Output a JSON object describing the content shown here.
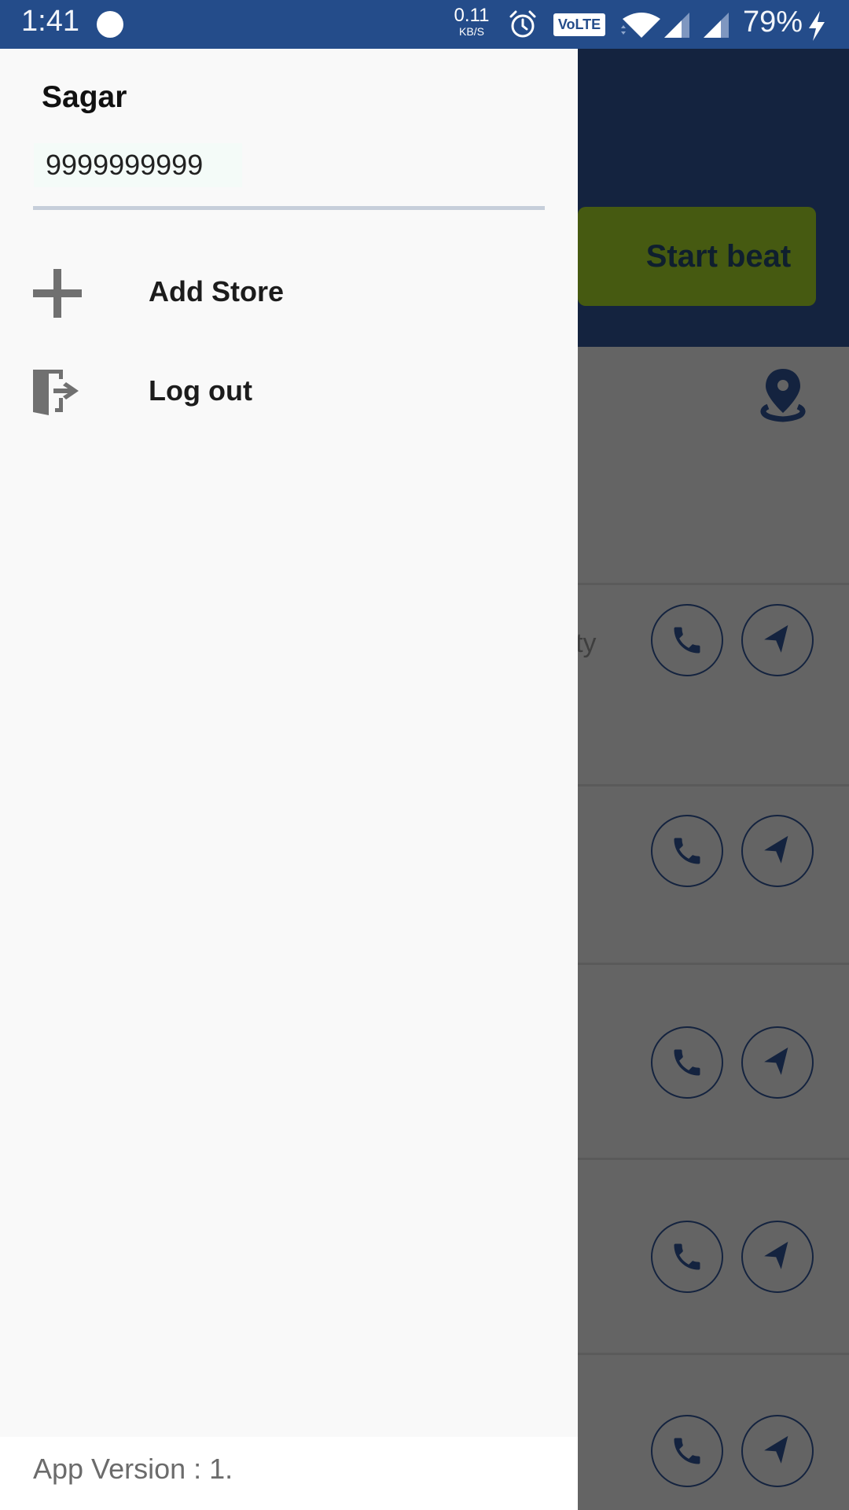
{
  "status_bar": {
    "time": "1:41",
    "net_speed_value": "0.11",
    "net_speed_unit": "KB/S",
    "volte_label": "VoLTE",
    "battery": "79%",
    "icons": [
      "notification-dot-icon",
      "alarm-icon",
      "volte-icon",
      "wifi-icon",
      "signal-icon",
      "signal-icon",
      "charging-bolt-icon"
    ]
  },
  "drawer": {
    "user_name": "Sagar",
    "user_phone": "9999999999",
    "menu": [
      {
        "label": "Add Store",
        "icon": "plus-icon"
      },
      {
        "label": "Log out",
        "icon": "logout-door-icon"
      }
    ],
    "app_version": "App Version : 1."
  },
  "background_app": {
    "start_beat_label": "Start beat",
    "location_icon": "location-pin-icon",
    "store_rows": [
      {
        "city": "City",
        "actions": [
          "call",
          "navigate"
        ]
      },
      {
        "city": "",
        "actions": [
          "call",
          "navigate"
        ]
      },
      {
        "city": "",
        "actions": [
          "call",
          "navigate"
        ]
      },
      {
        "city": "",
        "actions": [
          "call",
          "navigate"
        ]
      },
      {
        "city": "",
        "actions": [
          "call",
          "navigate"
        ]
      }
    ]
  },
  "colors": {
    "status_bar": "#244c8a",
    "header": "#14233f",
    "start_beat_bg": "#465a11",
    "scrim_body": "#646464",
    "icon_navy": "#14233f",
    "drawer_bg": "#f9f9f9"
  }
}
